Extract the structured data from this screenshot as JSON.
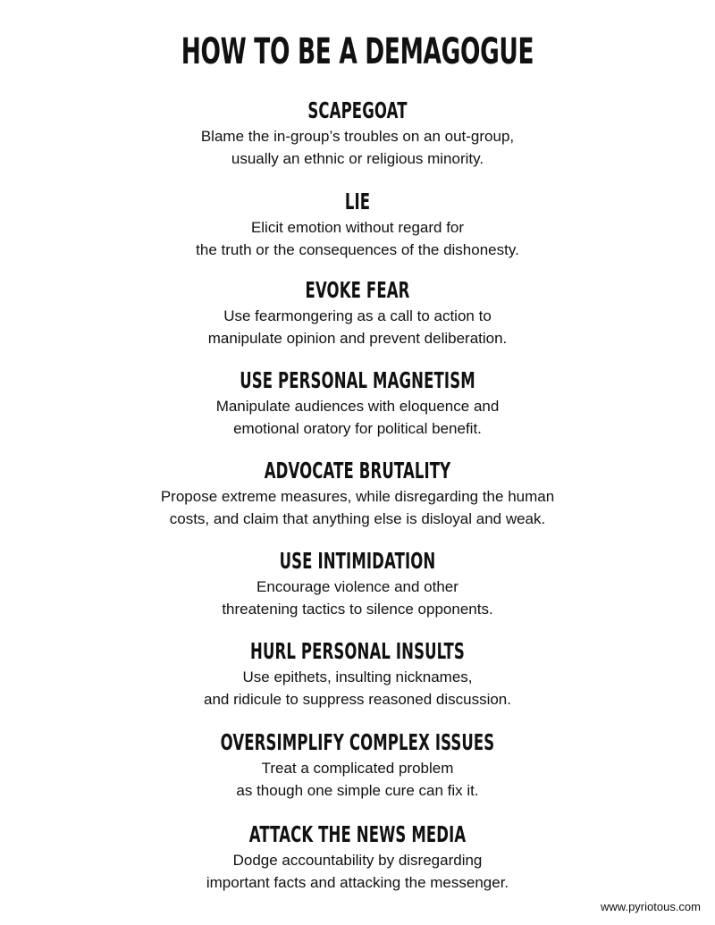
{
  "title": "HOW TO BE A DEMAGOGUE",
  "sections": [
    {
      "heading": "SCAPEGOAT",
      "lines": [
        "Blame the in-group’s troubles on an out-group,",
        "usually an ethnic or religious minority."
      ]
    },
    {
      "heading": "LIE",
      "lines": [
        "Elicit emotion without regard for",
        "the truth or the consequences of the dishonesty."
      ]
    },
    {
      "heading": "EVOKE FEAR",
      "lines": [
        "Use fearmongering as a call to action to",
        "manipulate opinion and prevent deliberation."
      ]
    },
    {
      "heading": "USE PERSONAL MAGNETISM",
      "lines": [
        "Manipulate audiences with eloquence and",
        "emotional oratory for political benefit."
      ]
    },
    {
      "heading": "ADVOCATE BRUTALITY",
      "lines": [
        "Propose extreme measures, while disregarding the human",
        "costs, and claim that anything else is disloyal and weak."
      ]
    },
    {
      "heading": "USE INTIMIDATION",
      "lines": [
        "Encourage violence and other",
        "threatening tactics to silence opponents."
      ]
    },
    {
      "heading": "HURL PERSONAL INSULTS",
      "lines": [
        "Use epithets, insulting nicknames,",
        "and ridicule to suppress reasoned discussion."
      ]
    },
    {
      "heading": "OVERSIMPLIFY COMPLEX ISSUES",
      "lines": [
        "Treat a complicated problem",
        "as though one simple cure can fix it."
      ]
    },
    {
      "heading": "ATTACK THE NEWS MEDIA",
      "lines": [
        "Dodge accountability by disregarding",
        "important facts and attacking the messenger."
      ]
    }
  ],
  "footer": {
    "url": "www.pyriotous.com"
  }
}
